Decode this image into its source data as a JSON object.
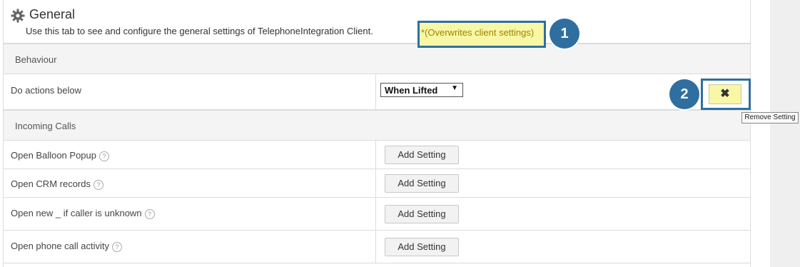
{
  "header": {
    "title": "General",
    "description": "Use this tab to see and configure the general settings of TelephoneIntegration Client.",
    "overwrite_note": "*(Overwrites client settings)"
  },
  "callouts": [
    "1",
    "2"
  ],
  "sections": {
    "behaviour": {
      "title": "Behaviour"
    },
    "incoming": {
      "title": "Incoming Calls"
    }
  },
  "behaviour_rows": [
    {
      "label": "Do actions below",
      "select_value": "When Lifted"
    }
  ],
  "incoming_rows": [
    {
      "label": "Open Balloon Popup",
      "help": "?",
      "button": "Add Setting"
    },
    {
      "label": "Open CRM records",
      "help": "?",
      "button": "Add Setting"
    },
    {
      "label": "Open new _ if caller is unknown",
      "help": "?",
      "button": "Add Setting"
    },
    {
      "label": "Open phone call activity",
      "help": "?",
      "button": "Add Setting"
    }
  ],
  "remove": {
    "symbol": "✖",
    "tooltip": "Remove Setting"
  },
  "select_arrow": "▼",
  "icons": {
    "header": "gear-icon",
    "help": "question-circle-icon",
    "remove": "close-icon"
  },
  "colors": {
    "callout": "#2f6f9f",
    "highlight": "#f7f7a6",
    "highlight_text": "#a08400"
  }
}
